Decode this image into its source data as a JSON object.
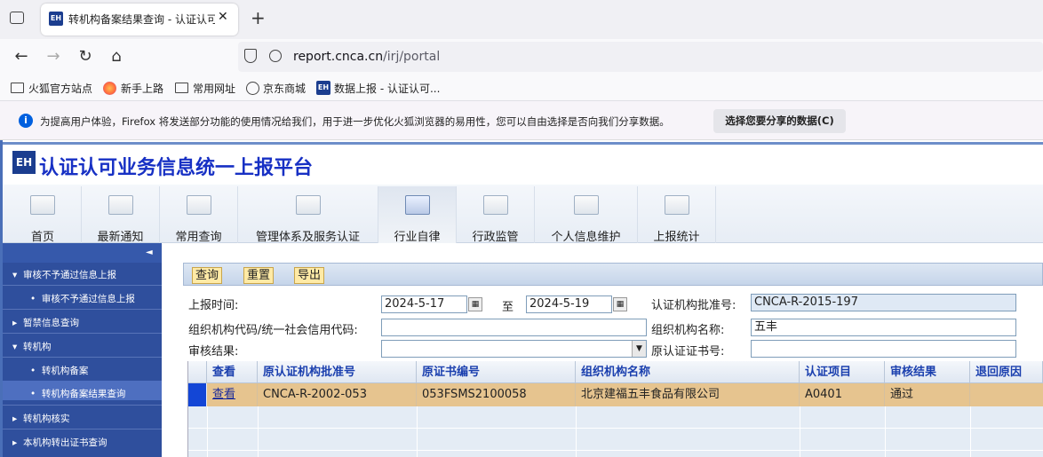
{
  "browser": {
    "tab_title": "转机构备案结果查询 - 认证认可…",
    "new_tab": "+",
    "url_host": "report.cnca.cn",
    "url_prefix": "",
    "url_path": "/irj/portal",
    "favicon_text": "EH",
    "bookmarks": [
      "火狐官方站点",
      "新手上路",
      "常用网址",
      "京东商城",
      "数据上报 - 认证认可..."
    ],
    "notice_text": "为提高用户体验，Firefox 将发送部分功能的使用情况给我们，用于进一步优化火狐浏览器的易用性，您可以自由选择是否向我们分享数据。",
    "notice_button": "选择您要分享的数据(C)"
  },
  "app": {
    "logo_text": "EH",
    "title": "认证认可业务信息统一上报平台",
    "menu": [
      "首页",
      "最新通知",
      "常用查询",
      "管理体系及服务认证",
      "行业自律",
      "行政监管",
      "个人信息维护",
      "上报统计"
    ],
    "active_menu": "行业自律"
  },
  "sidebar": {
    "collapse_glyph": "◄",
    "items": [
      {
        "label": "审核不予通过信息上报",
        "level": 1,
        "expanded": true
      },
      {
        "label": "审核不予通过信息上报",
        "level": 2
      },
      {
        "label": "暂禁信息查询",
        "level": 1,
        "expanded": false
      },
      {
        "label": "转机构",
        "level": 1,
        "expanded": true
      },
      {
        "label": "转机构备案",
        "level": 2
      },
      {
        "label": "转机构备案结果查询",
        "level": 2,
        "active": true
      },
      {
        "label": "转机构核实",
        "level": 1,
        "expanded": false
      },
      {
        "label": "本机构转出证书查询",
        "level": 1,
        "expanded": false
      }
    ]
  },
  "toolbar": {
    "query": "查询",
    "reset": "重置",
    "export": "导出"
  },
  "form": {
    "report_time_label": "上报时间:",
    "date_from": "2024-5-17",
    "to_label": "至",
    "date_to": "2024-5-19",
    "approval_no_label": "认证机构批准号:",
    "approval_no": "CNCA-R-2015-197",
    "org_code_label": "组织机构代码/统一社会信用代码:",
    "org_code": "",
    "org_name_label": "组织机构名称:",
    "org_name": "五丰",
    "audit_result_label": "审核结果:",
    "audit_result": "",
    "orig_cert_label": "原认证证书号:",
    "orig_cert": ""
  },
  "grid": {
    "columns": [
      "查看",
      "原认证机构批准号",
      "原证书编号",
      "组织机构名称",
      "认证项目",
      "审核结果",
      "退回原因"
    ],
    "rows": [
      [
        "查看",
        "CNCA-R-2002-053",
        "053FSMS2100058",
        "北京建福五丰食品有限公司",
        "A0401",
        "通过",
        ""
      ]
    ]
  },
  "colors": {
    "brand_blue": "#1730c4",
    "sidebar_bg": "#2f4f9d",
    "row_highlight": "#e6c48f"
  }
}
